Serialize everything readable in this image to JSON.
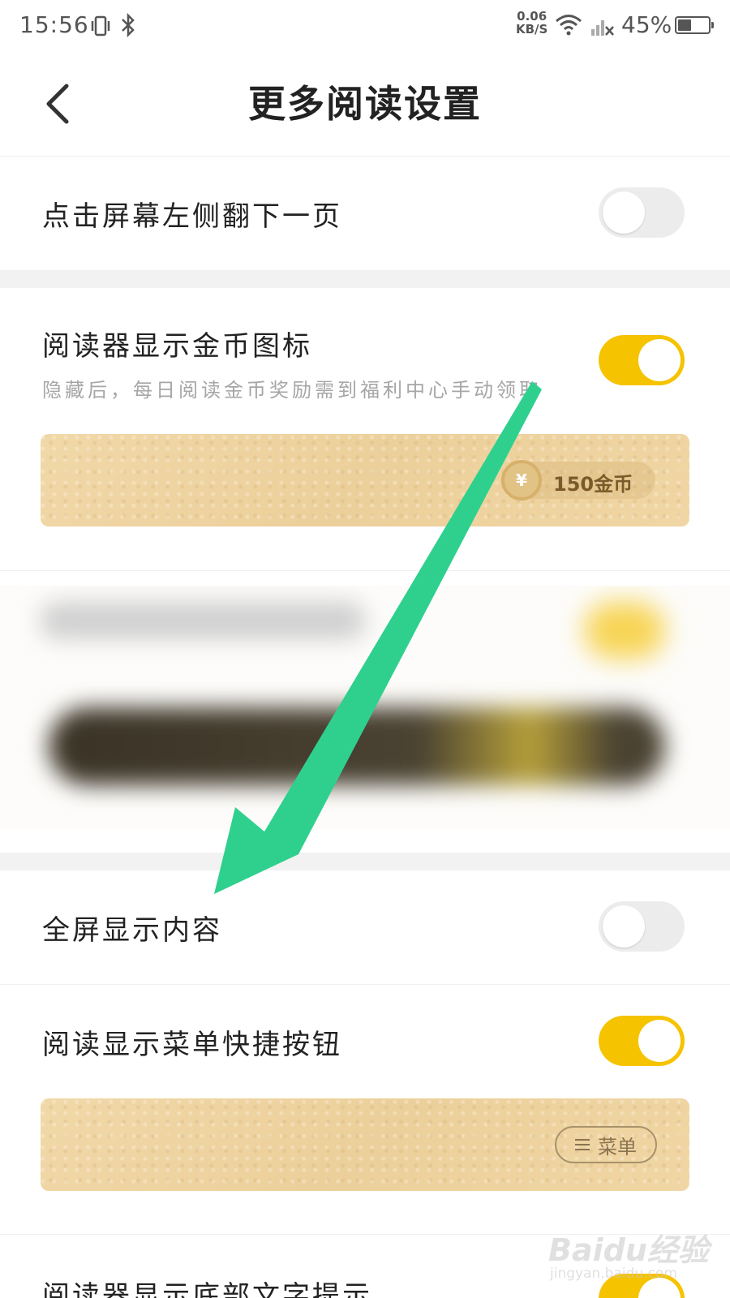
{
  "status_bar": {
    "time": "15:56",
    "net_speed_value": "0.06",
    "net_speed_unit": "KB/S",
    "battery": "45%",
    "battery_level": 0.45,
    "icons": [
      "vibrate-icon",
      "bluetooth-icon",
      "wifi-icon",
      "signal-off-icon",
      "battery-icon"
    ]
  },
  "header": {
    "title": "更多阅读设置",
    "back_icon": "chevron-left-icon"
  },
  "settings": [
    {
      "label": "点击屏幕左侧翻下一页",
      "enabled": false
    },
    {
      "label": "阅读器显示金币图标",
      "subtitle": "隐藏后，每日阅读金币奖励需到福利中心手动领取",
      "enabled": true,
      "preview": {
        "badge_text": "150金币",
        "coin_symbol": "¥"
      }
    },
    {
      "label": "全屏显示内容",
      "enabled": false
    },
    {
      "label": "阅读显示菜单快捷按钮",
      "enabled": true,
      "preview": {
        "badge_text": "菜单"
      }
    },
    {
      "label": "阅读器显示底部文字提示",
      "enabled": true
    }
  ],
  "annotation": {
    "arrow_color": "#2fd08e"
  },
  "watermark": {
    "brand": "Baidu经验",
    "url": "jingyan.baidu.com"
  },
  "colors": {
    "accent": "#f6c300",
    "toggle_off": "#ececec",
    "preview_bg": "#efd5a1"
  }
}
